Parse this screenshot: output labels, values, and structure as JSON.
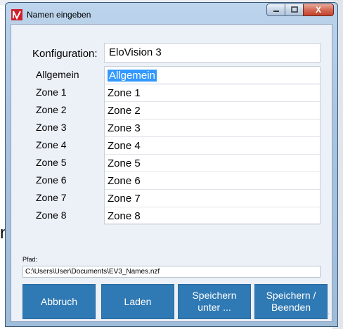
{
  "window": {
    "title": "Namen eingeben",
    "close_glyph": "X"
  },
  "konfiguration": {
    "label": "Konfiguration:",
    "value": "EloVision 3"
  },
  "names": {
    "labels": [
      "Allgemein",
      "Zone 1",
      "Zone 2",
      "Zone 3",
      "Zone 4",
      "Zone 5",
      "Zone 6",
      "Zone 7",
      "Zone 8"
    ],
    "values": [
      "Allgemein",
      "Zone 1",
      "Zone 2",
      "Zone 3",
      "Zone 4",
      "Zone 5",
      "Zone 6",
      "Zone 7",
      "Zone 8"
    ]
  },
  "pfad": {
    "label": "Pfad:",
    "value": "C:\\Users\\User\\Documents\\EV3_Names.nzf"
  },
  "buttons": {
    "abbruch": "Abbruch",
    "laden": "Laden",
    "speichern_unter_1": "Speichern",
    "speichern_unter_2": "unter ...",
    "speichern_beenden_1": "Speichern /",
    "speichern_beenden_2": "Beenden"
  },
  "background": {
    "glyph": "n"
  },
  "colors": {
    "button_bg": "#2f79b4",
    "selection": "#3399ff",
    "titlebar": "#bcd4ec"
  },
  "icons": {
    "app": "elovision-logo-icon",
    "minimize": "minimize-icon",
    "maximize": "maximize-icon",
    "close": "close-icon",
    "grip": "resize-grip-icon"
  }
}
